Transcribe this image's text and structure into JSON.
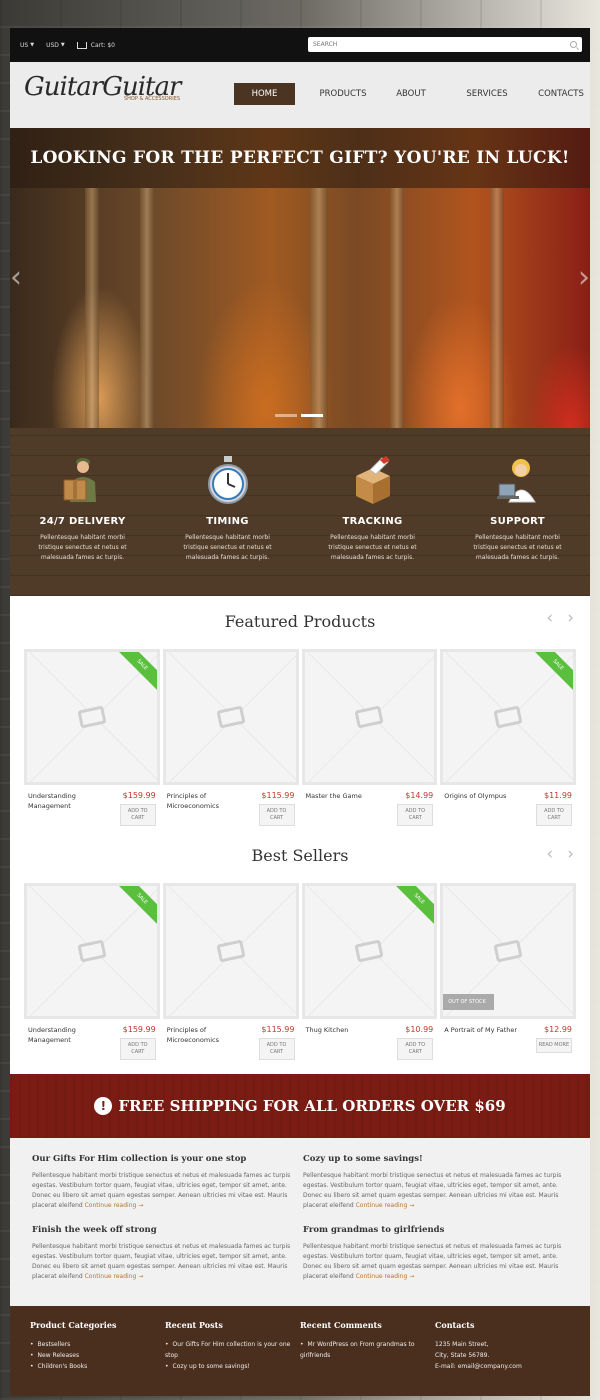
{
  "topbar": {
    "lang": "US",
    "currency": "USD",
    "cart": "Cart: $0",
    "search_placeholder": "SEARCH"
  },
  "header": {
    "logo": "GuitarGuitar",
    "tagline": "SHOP & ACCESSORIES",
    "nav": [
      "HOME",
      "PRODUCTS",
      "ABOUT",
      "SERVICES",
      "CONTACTS"
    ]
  },
  "hero": {
    "title": "LOOKING FOR THE PERFECT GIFT? YOU'RE IN LUCK!",
    "prev": "‹",
    "next": "›"
  },
  "features": [
    {
      "title": "24/7 DELIVERY",
      "text": "Pellentesque habitant morbi tristique senectus et netus et malesuada fames ac turpis.",
      "icon": "delivery-man-icon"
    },
    {
      "title": "TIMING",
      "text": "Pellentesque habitant morbi tristique senectus et netus et malesuada fames ac turpis.",
      "icon": "stopwatch-icon"
    },
    {
      "title": "TRACKING",
      "text": "Pellentesque habitant morbi tristique senectus et netus et malesuada fames ac turpis.",
      "icon": "box-tracking-icon"
    },
    {
      "title": "SUPPORT",
      "text": "Pellentesque habitant morbi tristique senectus et netus et malesuada fames ac turpis.",
      "icon": "support-operator-icon"
    }
  ],
  "featured": {
    "title": "Featured Products",
    "prev": "‹",
    "next": "›",
    "items": [
      {
        "name": "Understanding Management",
        "price": "$159.99",
        "button": "ADD TO CART",
        "sale": "SALE"
      },
      {
        "name": "Principles of Microeconomics",
        "price": "$115.99",
        "button": "ADD TO CART"
      },
      {
        "name": "Master the Game",
        "price": "$14.99",
        "button": "ADD TO CART"
      },
      {
        "name": "Origins of Olympus",
        "price": "$11.99",
        "button": "ADD TO CART",
        "sale": "SALE"
      }
    ]
  },
  "bestsellers": {
    "title": "Best Sellers",
    "prev": "‹",
    "next": "›",
    "items": [
      {
        "name": "Understanding Management",
        "price": "$159.99",
        "button": "ADD TO CART",
        "sale": "SALE"
      },
      {
        "name": "Principles of Microeconomics",
        "price": "$115.99",
        "button": "ADD TO CART"
      },
      {
        "name": "Thug Kitchen",
        "price": "$10.99",
        "button": "ADD TO CART",
        "sale": "SALE"
      },
      {
        "name": "A Portrait of My Father",
        "price": "$12.99",
        "button": "READ MORE",
        "stock": "OUT OF STOCK"
      }
    ]
  },
  "shipping": {
    "icon_text": "!",
    "text": "FREE SHIPPING FOR ALL ORDERS OVER $69"
  },
  "posts": [
    {
      "title": "Our Gifts For Him collection is your one stop",
      "text": "Pellentesque habitant morbi tristique senectus et netus et malesuada fames ac turpis egestas. Vestibulum tortor quam, feugiat vitae, ultricies eget, tempor sit amet, ante. Donec eu libero sit amet quam egestas semper. Aenean ultricies mi vitae est. Mauris placerat eleifend",
      "more": "Continue reading →"
    },
    {
      "title": "Cozy up to some savings!",
      "text": "Pellentesque habitant morbi tristique senectus et netus et malesuada fames ac turpis egestas. Vestibulum tortor quam, feugiat vitae, ultricies eget, tempor sit amet, ante. Donec eu libero sit amet quam egestas semper. Aenean ultricies mi vitae est. Mauris placerat eleifend",
      "more": "Continue reading →"
    },
    {
      "title": "Finish the week off strong",
      "text": "Pellentesque habitant morbi tristique senectus et netus et malesuada fames ac turpis egestas. Vestibulum tortor quam, feugiat vitae, ultricies eget, tempor sit amet, ante. Donec eu libero sit amet quam egestas semper. Aenean ultricies mi vitae est. Mauris placerat eleifend",
      "more": "Continue reading →"
    },
    {
      "title": "From grandmas to girlfriends",
      "text": "Pellentesque habitant morbi tristique senectus et netus et malesuada fames ac turpis egestas. Vestibulum tortor quam, feugiat vitae, ultricies eget, tempor sit amet, ante. Donec eu libero sit amet quam egestas semper. Aenean ultricies mi vitae est. Mauris placerat eleifend",
      "more": "Continue reading →"
    }
  ],
  "footer": {
    "categories": {
      "title": "Product Categories",
      "items": [
        "Bestsellers",
        "New Releases",
        "Children's Books"
      ]
    },
    "recent_posts": {
      "title": "Recent Posts",
      "items": [
        "Our Gifts For Him collection is your one stop",
        "Cozy up to some savings!"
      ]
    },
    "recent_comments": {
      "title": "Recent Comments",
      "items": [
        "Mr WordPress on From grandmas to girlfriends"
      ]
    },
    "contacts": {
      "title": "Contacts",
      "address1": "1235 Main Street,",
      "address2": "City, State 56789.",
      "email": "E-mail: email@company.com"
    }
  },
  "colors": {
    "accent": "#4b3422",
    "price": "#c0392b",
    "sale_badge": "#5bbf3e",
    "banner": "#7a1c14",
    "link": "#b5742a"
  }
}
